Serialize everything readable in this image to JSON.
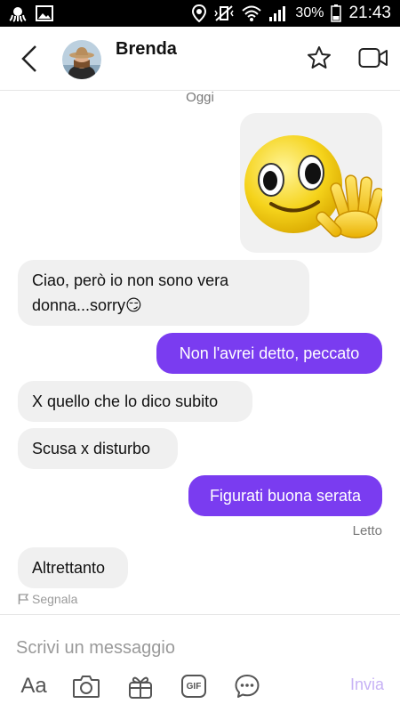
{
  "status_bar": {
    "battery": "30%",
    "time": "21:43"
  },
  "header": {
    "contact_name": "Brenda"
  },
  "chat": {
    "date_separator": "Oggi",
    "messages": [
      {
        "direction": "in",
        "text": "Ciao, però io non sono vera donna...sorry😏"
      },
      {
        "direction": "out",
        "text": "Non l'avrei detto, peccato"
      },
      {
        "direction": "in",
        "text": "X quello che lo dico subito"
      },
      {
        "direction": "in",
        "text": "Scusa x disturbo"
      },
      {
        "direction": "out",
        "text": "Figurati buona serata"
      },
      {
        "direction": "in",
        "text": "Altrettanto"
      }
    ],
    "read_status": "Letto",
    "report_label": "Segnala"
  },
  "composer": {
    "placeholder": "Scrivi un messaggio",
    "font_tool_label": "Aa",
    "gif_label": "GIF",
    "send_label": "Invia"
  },
  "colors": {
    "accent": "#7a3cf0",
    "incoming_bubble": "#f0f0f0",
    "send_disabled": "#c7b2f5"
  }
}
